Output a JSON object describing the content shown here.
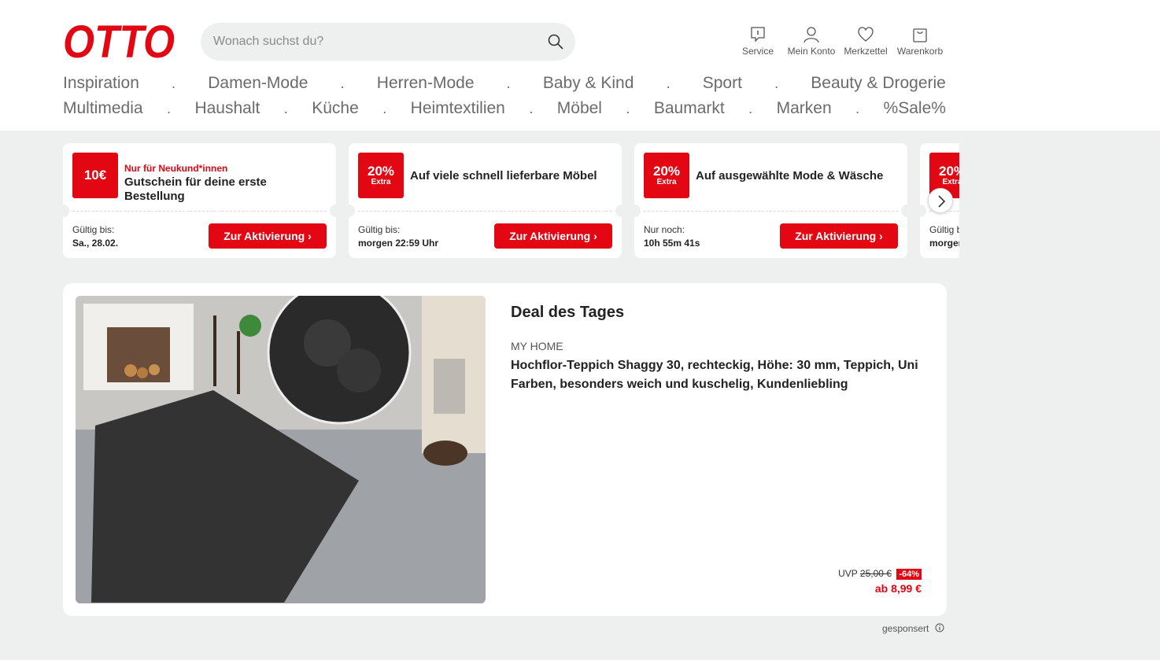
{
  "brand": {
    "logo_text": "OTTO",
    "accent_color": "#e30613"
  },
  "search": {
    "placeholder": "Wonach suchst du?",
    "icon": "search-icon"
  },
  "header_icons": [
    {
      "label": "Service",
      "icon": "service-icon"
    },
    {
      "label": "Mein Konto",
      "icon": "user-icon"
    },
    {
      "label": "Merkzettel",
      "icon": "heart-icon"
    },
    {
      "label": "Warenkorb",
      "icon": "cart-icon"
    }
  ],
  "nav": {
    "row1": [
      "Inspiration",
      "Damen-Mode",
      "Herren-Mode",
      "Baby & Kind",
      "Sport",
      "Beauty & Drogerie"
    ],
    "row2": [
      "Multimedia",
      "Haushalt",
      "Küche",
      "Heimtextilien",
      "Möbel",
      "Baumarkt",
      "Marken",
      "%Sale%"
    ],
    "separator": "."
  },
  "coupons": [
    {
      "badge_big": "10€",
      "badge_small": "",
      "tagline": "Nur für Neukund*innen",
      "title": "Gutschein für deine erste Bestellung",
      "valid_label": "Gültig bis:",
      "valid_value": "Sa., 28.02.",
      "button": "Zur Aktivierung"
    },
    {
      "badge_big": "20%",
      "badge_small": "Extra",
      "tagline": "",
      "title": "Auf viele schnell lieferbare Möbel",
      "valid_label": "Gültig bis:",
      "valid_value": "morgen 22:59 Uhr",
      "button": "Zur Aktivierung"
    },
    {
      "badge_big": "20%",
      "badge_small": "Extra",
      "tagline": "",
      "title": "Auf ausgewählte Mode & Wäsche",
      "valid_label": "Nur noch:",
      "valid_value": "10h 55m 41s",
      "button": "Zur Aktivierung"
    },
    {
      "badge_big": "20%",
      "badge_small": "Extra",
      "tagline": "",
      "title": "",
      "valid_label": "Gültig bis:",
      "valid_value": "morgen",
      "button": ""
    }
  ],
  "deal": {
    "heading": "Deal des Tages",
    "brand": "MY HOME",
    "name": "Hochflor-Teppich Shaggy 30, rechteckig, Höhe: 30 mm, Teppich, Uni Farben, besonders weich und kuschelig, Kundenliebling",
    "uvp_label": "UVP",
    "old_price": "25,00 €",
    "discount": "-64%",
    "price": "ab 8,99 €"
  },
  "sponsored": "gesponsert"
}
